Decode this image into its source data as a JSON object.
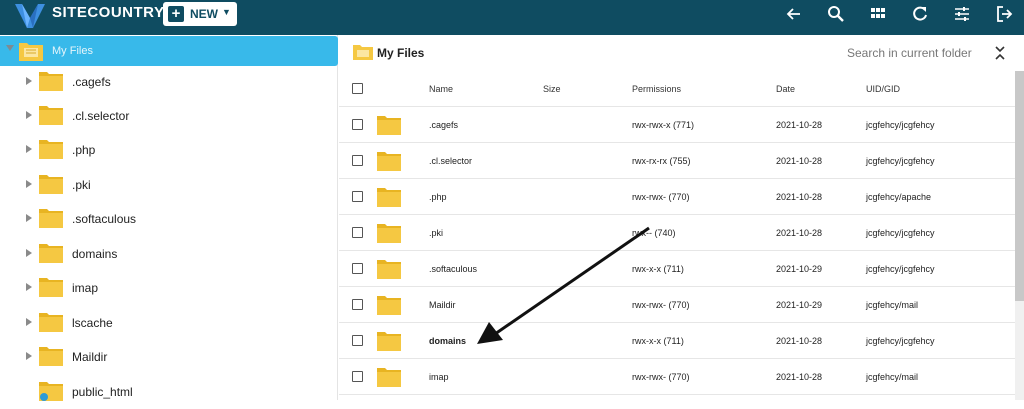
{
  "app": {
    "brand": "SITECOUNTRY"
  },
  "toolbar": {
    "new_label": "NEW",
    "icons": [
      "back-arrow-icon",
      "search-icon",
      "grid-view-icon",
      "refresh-icon",
      "settings-sliders-icon",
      "logout-icon"
    ]
  },
  "tree": {
    "root_label": "My Files",
    "items": [
      {
        "label": ".cagefs"
      },
      {
        "label": ".cl.selector"
      },
      {
        "label": ".php"
      },
      {
        "label": ".pki"
      },
      {
        "label": ".softaculous"
      },
      {
        "label": "domains"
      },
      {
        "label": "imap"
      },
      {
        "label": "lscache"
      },
      {
        "label": "Maildir"
      },
      {
        "label": "public_html"
      }
    ]
  },
  "content": {
    "title": "My Files",
    "search_placeholder": "Search in current folder",
    "columns": {
      "name": "Name",
      "size": "Size",
      "permissions": "Permissions",
      "date": "Date",
      "uid": "UID/GID"
    },
    "rows": [
      {
        "name": ".cagefs",
        "size": "",
        "permissions": "rwx-rwx-x (771)",
        "date": "2021-10-28",
        "uid": "jcgfehcy/jcgfehcy"
      },
      {
        "name": ".cl.selector",
        "size": "",
        "permissions": "rwx-rx-rx (755)",
        "date": "2021-10-28",
        "uid": "jcgfehcy/jcgfehcy"
      },
      {
        "name": ".php",
        "size": "",
        "permissions": "rwx-rwx- (770)",
        "date": "2021-10-28",
        "uid": "jcgfehcy/apache"
      },
      {
        "name": ".pki",
        "size": "",
        "permissions": "rwx-- (740)",
        "date": "2021-10-28",
        "uid": "jcgfehcy/jcgfehcy"
      },
      {
        "name": ".softaculous",
        "size": "",
        "permissions": "rwx-x-x (711)",
        "date": "2021-10-29",
        "uid": "jcgfehcy/jcgfehcy"
      },
      {
        "name": "Maildir",
        "size": "",
        "permissions": "rwx-rwx- (770)",
        "date": "2021-10-29",
        "uid": "jcgfehcy/mail"
      },
      {
        "name": "domains",
        "size": "",
        "permissions": "rwx-x-x (711)",
        "date": "2021-10-28",
        "uid": "jcgfehcy/jcgfehcy"
      },
      {
        "name": "imap",
        "size": "",
        "permissions": "rwx-rwx- (770)",
        "date": "2021-10-28",
        "uid": "jcgfehcy/mail"
      }
    ]
  },
  "colors": {
    "topbar": "#0f4c61",
    "selected": "#38b9ea",
    "folder": "#f5c842",
    "folder_tab": "#e8b422"
  }
}
